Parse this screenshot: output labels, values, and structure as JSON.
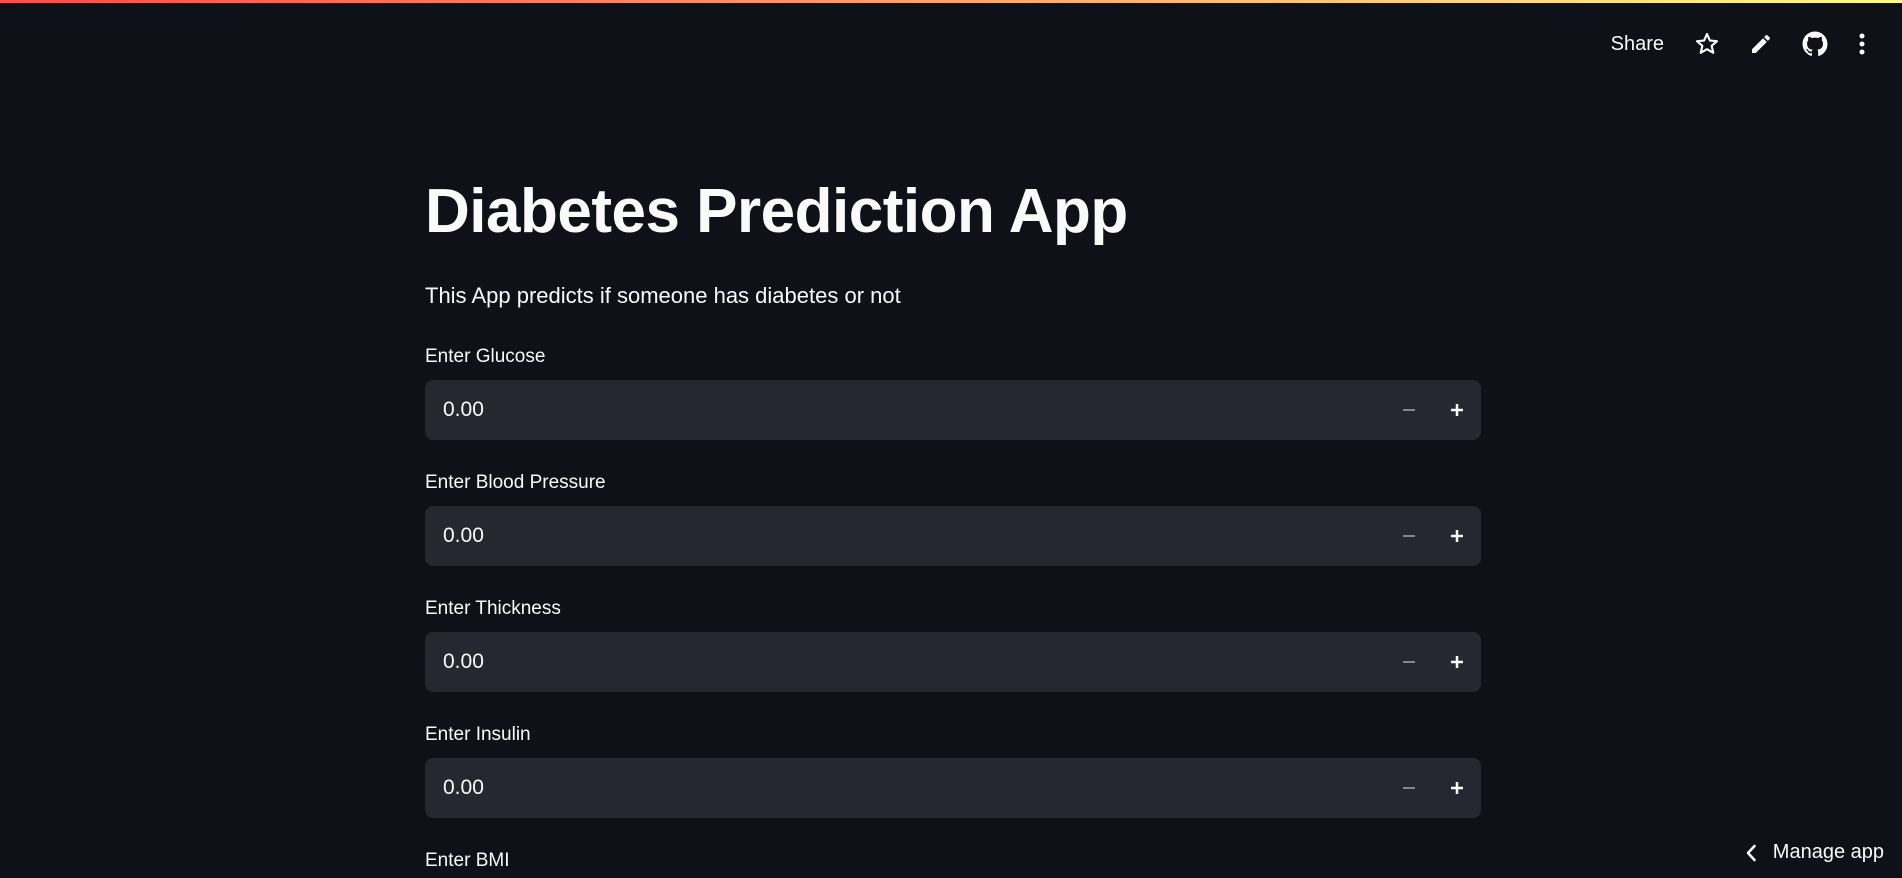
{
  "toolbar": {
    "share_label": "Share"
  },
  "main": {
    "title": "Diabetes Prediction App",
    "subtitle": "This App predicts if someone has diabetes or not",
    "fields": [
      {
        "label": "Enter Glucose",
        "value": "0.00"
      },
      {
        "label": "Enter Blood Pressure",
        "value": "0.00"
      },
      {
        "label": "Enter Thickness",
        "value": "0.00"
      },
      {
        "label": "Enter Insulin",
        "value": "0.00"
      },
      {
        "label": "Enter BMI",
        "value": ""
      }
    ]
  },
  "footer": {
    "manage_label": "Manage app"
  },
  "colors": {
    "background": "#0e1117",
    "input_background": "#262730",
    "text": "#fafafa",
    "gradient_start": "#ff4b4b",
    "gradient_end": "#fffd80"
  },
  "icons": [
    "star-icon",
    "edit-icon",
    "github-icon",
    "more-vertical-icon",
    "minus-icon",
    "plus-icon",
    "chevron-left-icon"
  ]
}
